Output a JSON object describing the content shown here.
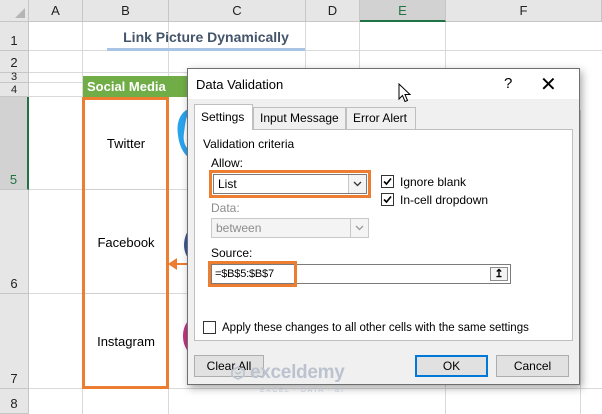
{
  "sheet": {
    "columns": [
      "A",
      "B",
      "C",
      "D",
      "E",
      "F"
    ],
    "rows": [
      "1",
      "2",
      "3",
      "4",
      "5",
      "6",
      "7",
      "8"
    ],
    "title": "Link Picture Dynamically",
    "header": "Social Media",
    "items": [
      "Twitter",
      "Facebook",
      "Instagram"
    ]
  },
  "dialog": {
    "title": "Data Validation",
    "help": "?",
    "close": "✕",
    "tabs": [
      "Settings",
      "Input Message",
      "Error Alert"
    ],
    "validation_criteria": "Validation criteria",
    "allow_label": "Allow:",
    "allow_value": "List",
    "ignore_blank": "Ignore blank",
    "in_cell_dropdown": "In-cell dropdown",
    "data_label": "Data:",
    "data_value": "between",
    "source_label": "Source:",
    "source_value": "=$B$5:$B$7",
    "apply_all": "Apply these changes to all other cells with the same settings",
    "clear_all": "Clear All",
    "ok": "OK",
    "cancel": "Cancel"
  },
  "watermark": {
    "brand": "exceldemy",
    "tagline": "EXCEL · DATA · BI"
  },
  "colors": {
    "accent_orange": "#ed7d31",
    "header_green": "#70ad47",
    "focus_blue": "#0078d7"
  }
}
